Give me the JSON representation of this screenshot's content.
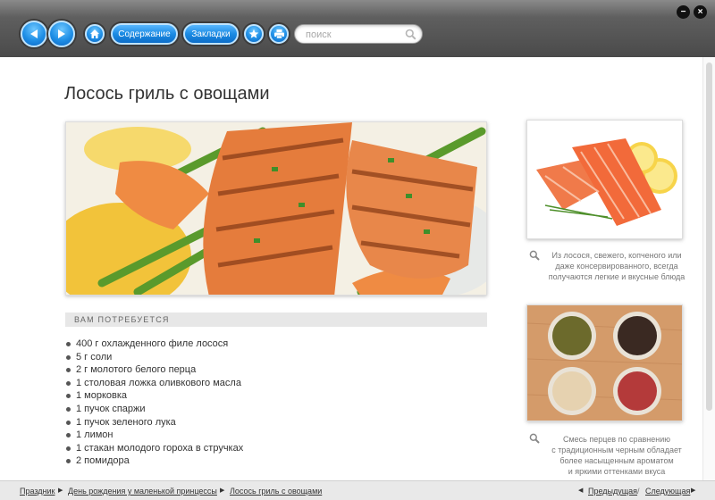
{
  "toolbar": {
    "contents_label": "Содержание",
    "bookmarks_label": "Закладки",
    "search_placeholder": "поиск"
  },
  "article": {
    "title": "Лосось гриль с овощами",
    "needs_heading": "ВАМ ПОТРЕБУЕТСЯ",
    "ingredients": [
      "400 г охлажденного филе лосося",
      "5 г соли",
      "2 г молотого белого перца",
      "1 столовая ложка оливкового масла",
      "1 морковка",
      "1 пучок спаржи",
      "1 пучок зеленого лука",
      "1 лимон",
      "1 стакан молодого гороха в стручках",
      "2 помидора"
    ]
  },
  "sidebar": {
    "captions": [
      [
        "Из лосося, свежего, копченого или",
        "даже консервированного, всегда",
        "получаются легкие и вкусные блюда"
      ],
      [
        "Смесь перцев по сравнению",
        "с традиционным черным обладает",
        "более насыщенным ароматом",
        "и яркими оттенками вкуса"
      ]
    ]
  },
  "breadcrumb": {
    "items": [
      "Праздник",
      "День рождения у маленькой принцессы",
      "Лосось гриль с овощами"
    ],
    "prev_label": "Предыдущая",
    "next_label": "Следующая",
    "divider": "/"
  },
  "icons": [
    "back-arrow-icon",
    "forward-arrow-icon",
    "home-icon",
    "star-icon",
    "print-icon",
    "search-icon",
    "minimize-icon",
    "close-icon",
    "magnifier-icon",
    "triangle-separator-icon"
  ],
  "colors": {
    "button_blue": "#1b8be3",
    "toolbar_gray": "#4a4a4a",
    "bar_gray": "#e7e7e7"
  }
}
